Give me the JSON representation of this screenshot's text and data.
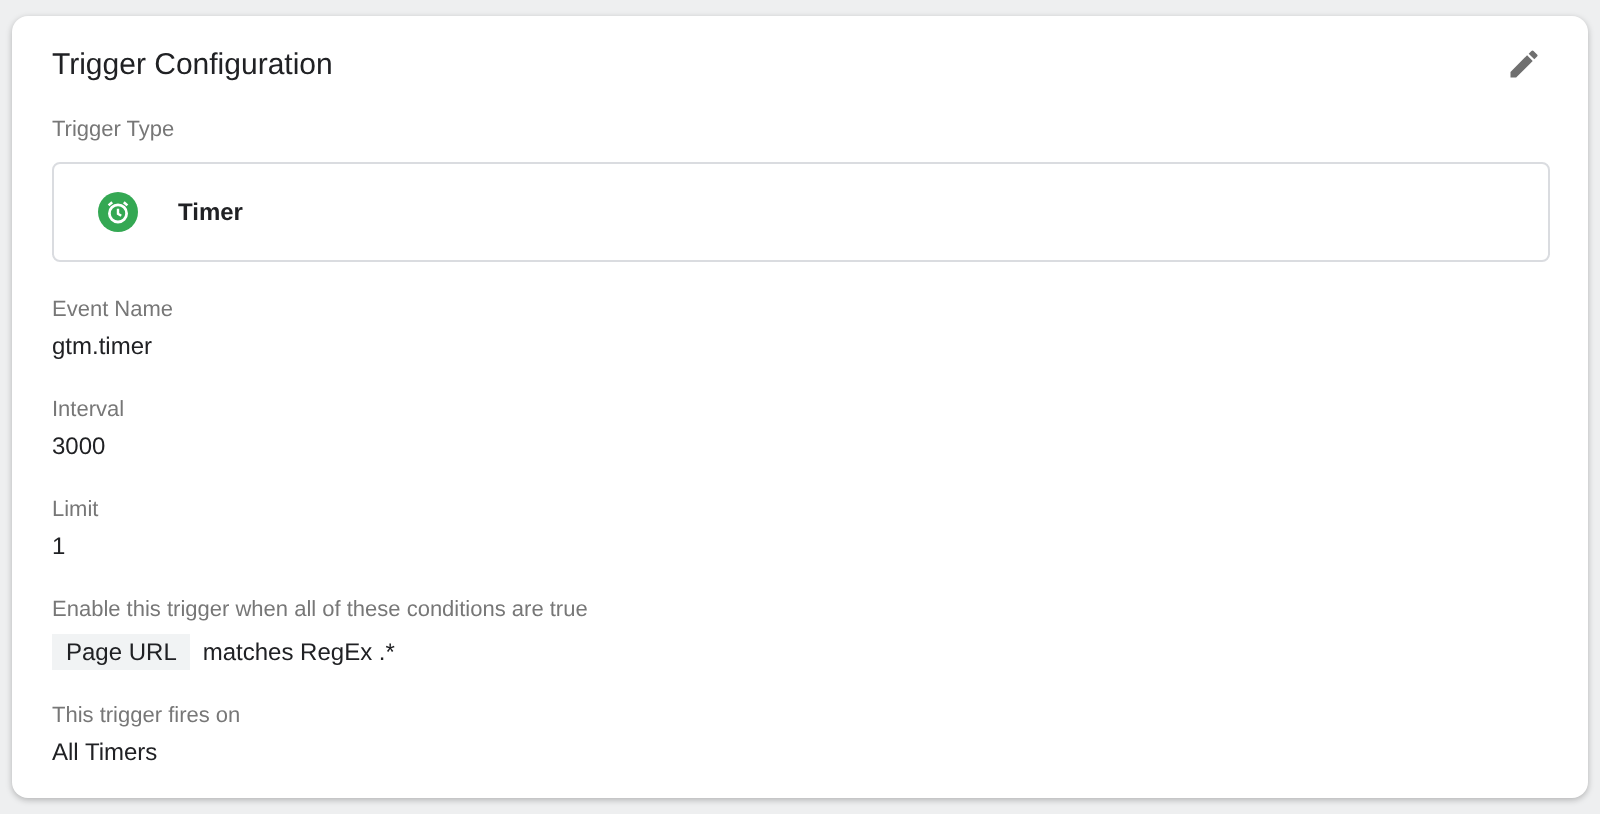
{
  "card": {
    "title": "Trigger Configuration"
  },
  "trigger_type": {
    "label": "Trigger Type",
    "value": "Timer"
  },
  "fields": [
    {
      "label": "Event Name",
      "value": "gtm.timer"
    },
    {
      "label": "Interval",
      "value": "3000"
    },
    {
      "label": "Limit",
      "value": "1"
    }
  ],
  "conditions": {
    "label": "Enable this trigger when all of these conditions are true",
    "rows": [
      {
        "variable": "Page URL",
        "rule": "matches RegEx .*"
      }
    ]
  },
  "fires_on": {
    "label": "This trigger fires on",
    "value": "All Timers"
  }
}
